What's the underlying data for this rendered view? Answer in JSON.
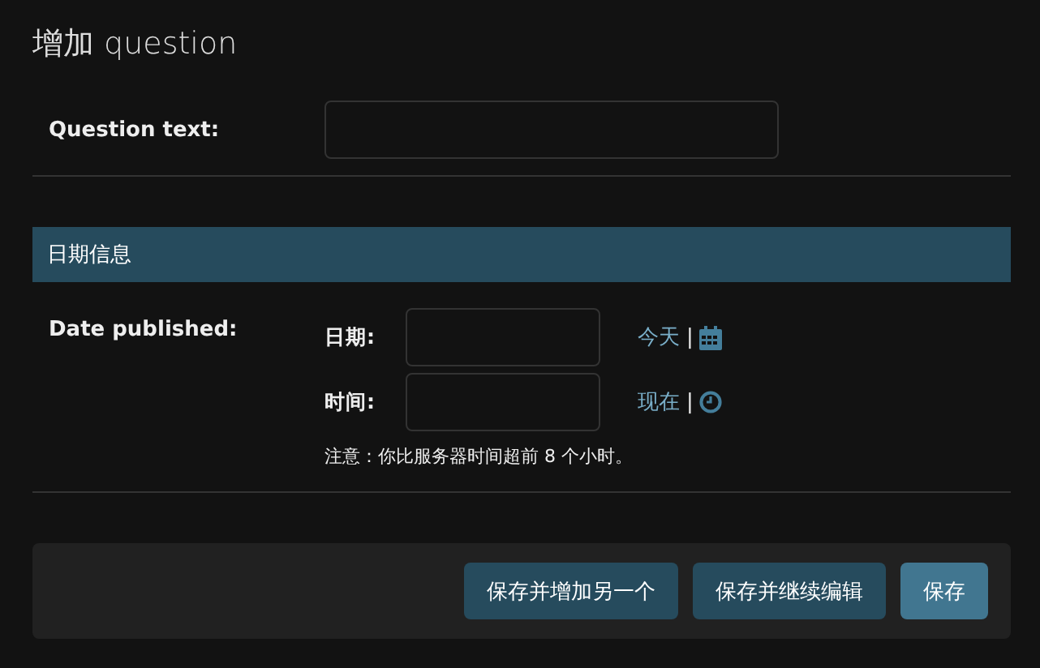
{
  "title": "增加 question",
  "question_field": {
    "label": "Question text:"
  },
  "fieldset": {
    "title": "日期信息",
    "label": "Date published:",
    "rows": [
      {
        "label": "日期:",
        "shortcut": "今天",
        "separator": "|",
        "kind": "date"
      },
      {
        "label": "时间:",
        "shortcut": "现在",
        "separator": "|",
        "kind": "time"
      }
    ],
    "note": "注意：你比服务器时间超前 8 个小时。"
  },
  "buttons": [
    {
      "label": "保存并增加另一个",
      "kind": "normal"
    },
    {
      "label": "保存并继续编辑",
      "kind": "normal"
    },
    {
      "label": "保存",
      "kind": "default"
    }
  ]
}
